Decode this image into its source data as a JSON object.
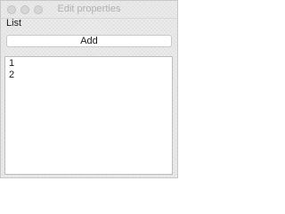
{
  "window": {
    "title": "Edit properties"
  },
  "section": {
    "label": "List"
  },
  "toolbar": {
    "add_label": "Add"
  },
  "list": {
    "items": [
      "1",
      "2"
    ]
  },
  "colors": {
    "window_bg": "#ececec",
    "list_bg": "#ffffff",
    "text": "#1a1a1a",
    "title_text": "#b0b0b0"
  }
}
